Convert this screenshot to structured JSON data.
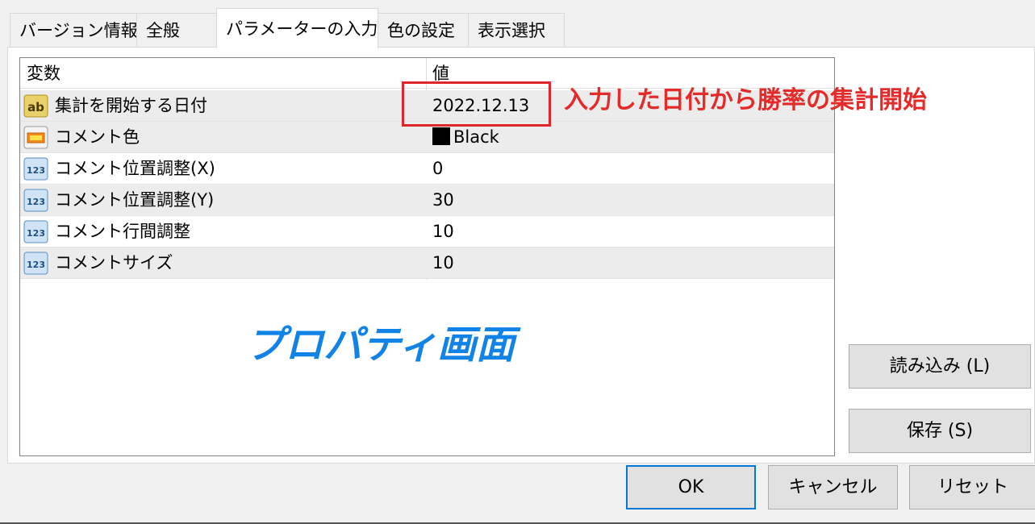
{
  "tabs": [
    {
      "label": "バージョン情報",
      "active": false
    },
    {
      "label": "全般",
      "active": false
    },
    {
      "label": "パラメーターの入力",
      "active": true
    },
    {
      "label": "色の設定",
      "active": false
    },
    {
      "label": "表示選択",
      "active": false
    }
  ],
  "table": {
    "headers": {
      "name": "変数",
      "value": "値"
    },
    "rows": [
      {
        "icon": "string-ab-icon",
        "name": "集計を開始する日付",
        "value": "2022.12.13"
      },
      {
        "icon": "color-icon",
        "name": "コメント色",
        "value": "Black",
        "swatch_color": "#000000"
      },
      {
        "icon": "integer-123-icon",
        "name": "コメント位置調整(X)",
        "value": "0"
      },
      {
        "icon": "integer-123-icon",
        "name": "コメント位置調整(Y)",
        "value": "30"
      },
      {
        "icon": "integer-123-icon",
        "name": "コメント行間調整",
        "value": "10"
      },
      {
        "icon": "integer-123-icon",
        "name": "コメントサイズ",
        "value": "10"
      }
    ]
  },
  "annotations": {
    "red_note": "入力した日付から勝率の集計開始",
    "blue_note": "プロパティ画面",
    "red_color": "#e52a2a",
    "blue_color": "#1183e6"
  },
  "buttons": {
    "load": "読み込み (L)",
    "save": "保存 (S)",
    "ok": "OK",
    "cancel": "キャンセル",
    "reset": "リセット"
  }
}
